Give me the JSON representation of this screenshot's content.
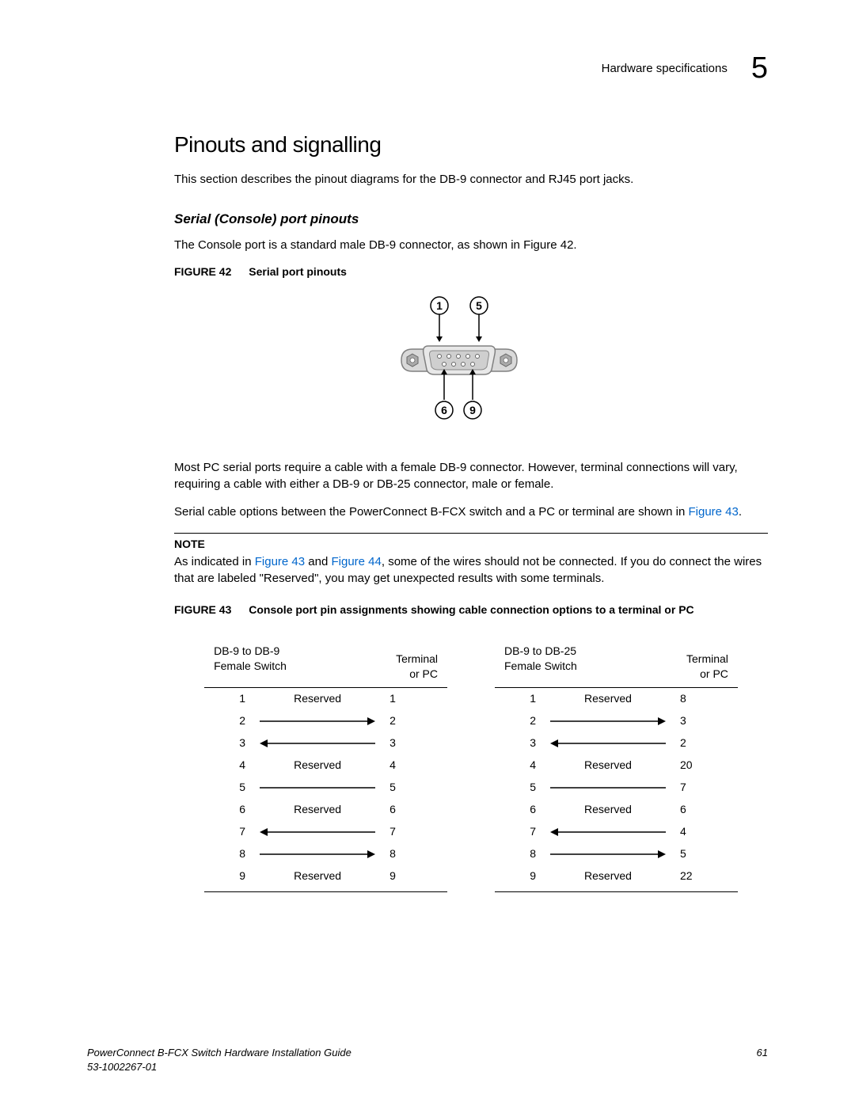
{
  "header": {
    "section": "Hardware specifications",
    "chapter": "5"
  },
  "title": "Pinouts and signalling",
  "intro": "This section describes the pinout diagrams for the DB-9 connector and RJ45 port jacks.",
  "sub1": "Serial (Console) port pinouts",
  "sub1_text": "The Console port is a standard male DB-9 connector, as shown in Figure 42.",
  "fig42_label": "FIGURE 42",
  "fig42_title": "Serial port pinouts",
  "db9_pins": {
    "tl": "1",
    "tr": "5",
    "bl": "6",
    "br": "9"
  },
  "para2": "Most PC serial ports require a cable with a female DB-9 connector. However, terminal connections will vary, requiring a cable with either a DB-9 or DB-25 connector, male or female.",
  "para3a": "Serial cable options between the PowerConnect B-FCX switch and a PC or terminal are shown in ",
  "para3b": "Figure 43",
  "para3c": ".",
  "note_label": "NOTE",
  "note_a": "As indicated in ",
  "note_b": "Figure 43",
  "note_c": " and ",
  "note_d": "Figure 44",
  "note_e": ", some of the wires should not be connected. If you do connect the wires that are labeled \"Reserved\", you may get unexpected results with some terminals.",
  "fig43_label": "FIGURE 43",
  "fig43_title": "Console port pin assignments showing cable connection options to a terminal or PC",
  "tableA": {
    "h1": "DB-9 to DB-9",
    "h2": "Female Switch",
    "h3": "Terminal or PC",
    "rows": [
      {
        "l": "1",
        "type": "reserved",
        "r": "1"
      },
      {
        "l": "2",
        "type": "right",
        "r": "2"
      },
      {
        "l": "3",
        "type": "left",
        "r": "3"
      },
      {
        "l": "4",
        "type": "reserved",
        "r": "4"
      },
      {
        "l": "5",
        "type": "line",
        "r": "5"
      },
      {
        "l": "6",
        "type": "reserved",
        "r": "6"
      },
      {
        "l": "7",
        "type": "left",
        "r": "7"
      },
      {
        "l": "8",
        "type": "right",
        "r": "8"
      },
      {
        "l": "9",
        "type": "reserved",
        "r": "9"
      }
    ]
  },
  "tableB": {
    "h1": "DB-9 to DB-25",
    "h2": "Female Switch",
    "h3": "Terminal or PC",
    "rows": [
      {
        "l": "1",
        "type": "reserved",
        "r": "8"
      },
      {
        "l": "2",
        "type": "right",
        "r": "3"
      },
      {
        "l": "3",
        "type": "left",
        "r": "2"
      },
      {
        "l": "4",
        "type": "reserved",
        "r": "20"
      },
      {
        "l": "5",
        "type": "line",
        "r": "7"
      },
      {
        "l": "6",
        "type": "reserved",
        "r": "6"
      },
      {
        "l": "7",
        "type": "left",
        "r": "4"
      },
      {
        "l": "8",
        "type": "right",
        "r": "5"
      },
      {
        "l": "9",
        "type": "reserved",
        "r": "22"
      }
    ]
  },
  "reserved_text": "Reserved",
  "footer": {
    "title": "PowerConnect B-FCX Switch Hardware Installation Guide",
    "docnum": "53-1002267-01",
    "page": "61"
  }
}
